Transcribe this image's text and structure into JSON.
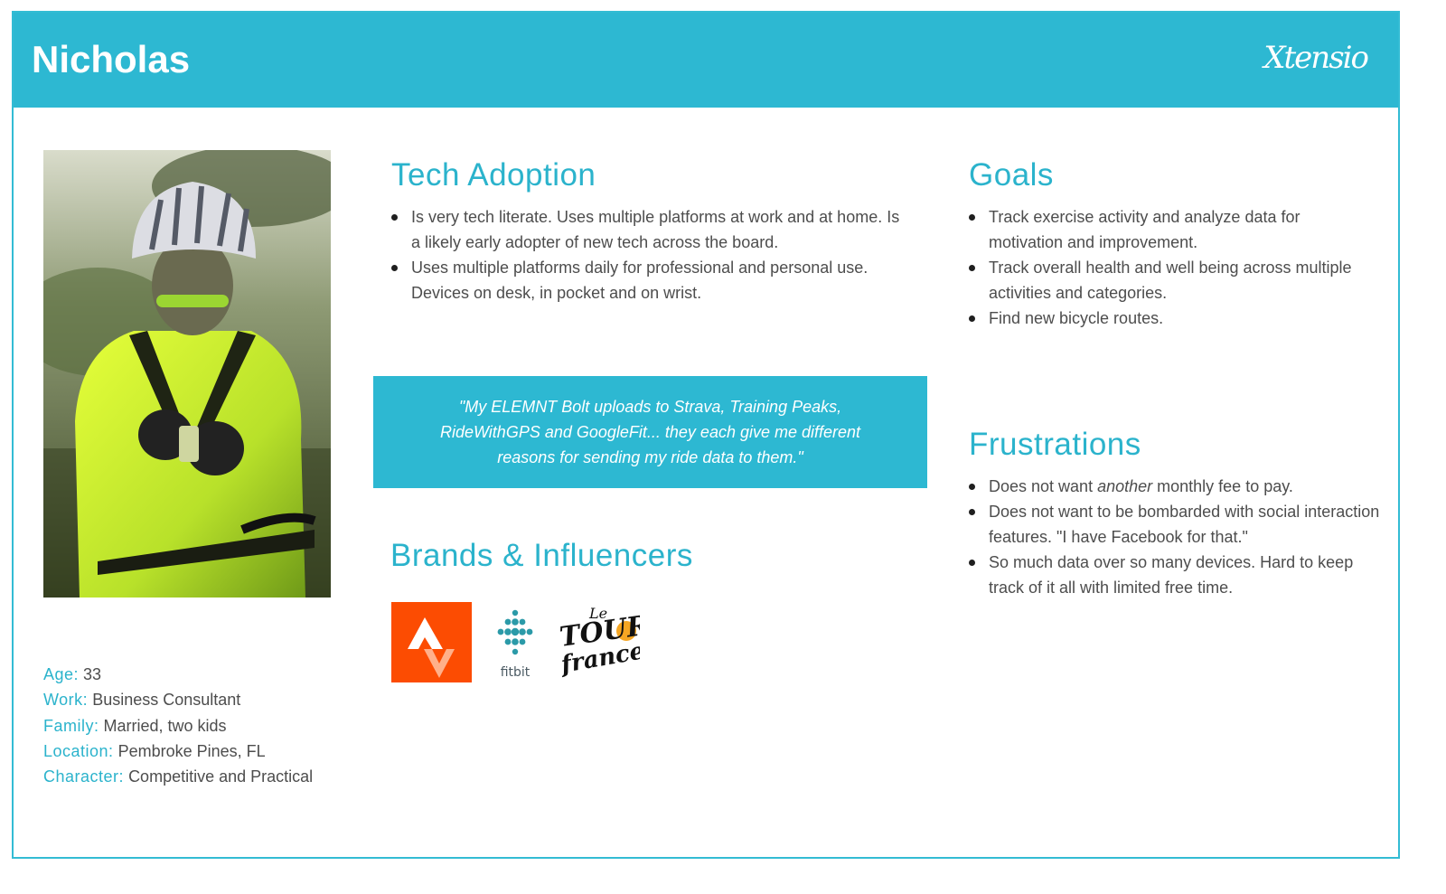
{
  "header": {
    "name": "Nicholas",
    "logo_text": "Xtensio"
  },
  "colors": {
    "accent": "#2db8d2",
    "title": "#2bb3cc",
    "strava": "#fc4c02"
  },
  "photo": {
    "description_icon": "cyclist-photo"
  },
  "tech_adoption": {
    "title": "Tech Adoption",
    "items": [
      "Is very tech literate.  Uses multiple platforms at work and at home.  Is a likely early adopter of new tech across the board.",
      "Uses multiple platforms daily for professional and personal use.  Devices on desk, in pocket and on wrist."
    ]
  },
  "quote": "\"My ELEMNT Bolt uploads to Strava, Training Peaks, RideWithGPS and GoogleFit... they each give me different reasons for sending my ride data to them.\"",
  "brands": {
    "title": "Brands & Influencers",
    "fitbit_label": "fitbit",
    "tdf_label": "Le Tour de France"
  },
  "goals": {
    "title": "Goals",
    "items": [
      "Track exercise activity and analyze data for motivation and improvement.",
      "Track overall health and well being across multiple activities and categories.",
      "Find new bicycle routes."
    ]
  },
  "frustrations": {
    "title": "Frustrations",
    "item1_pre": "Does not want ",
    "item1_em": "another",
    "item1_post": " monthly fee to pay.",
    "item2": "Does not want to be bombarded with social interaction features.  \"I have Facebook for that.\"",
    "item3": "So much data over so many devices.  Hard to keep track of it all with limited free time."
  },
  "details": {
    "age_label": "Age:",
    "age": "33",
    "work_label": "Work:",
    "work": "Business Consultant",
    "family_label": "Family:",
    "family": "Married, two kids",
    "location_label": "Location:",
    "location": "Pembroke Pines, FL",
    "character_label": "Character:",
    "character": "Competitive and Practical"
  }
}
